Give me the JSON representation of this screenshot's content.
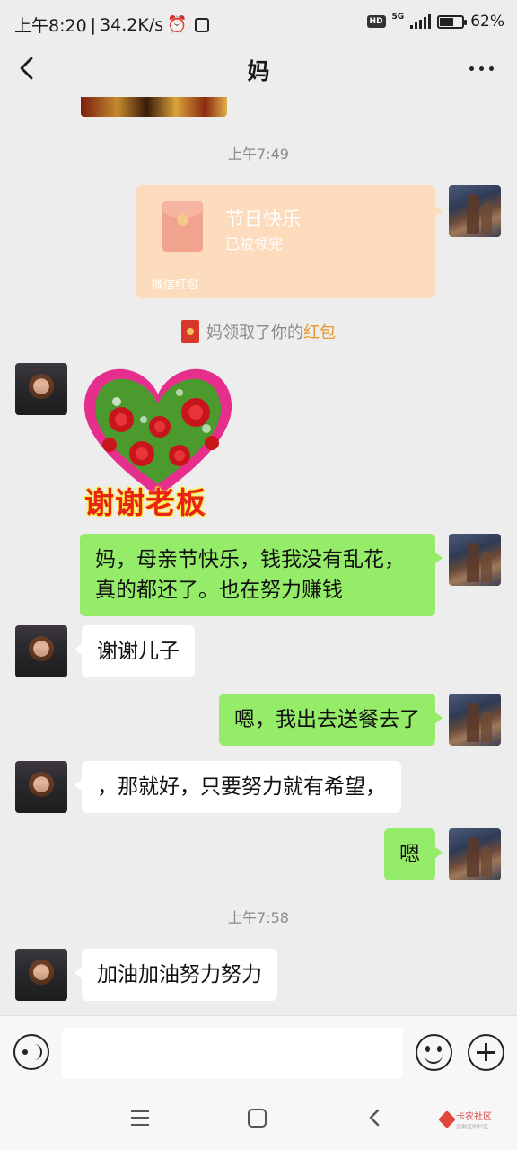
{
  "status_bar": {
    "time": "上午8:20",
    "separator": "|",
    "speed": "34.2K/s",
    "hd_badge": "HD",
    "network": "5G",
    "battery_percent": "62%",
    "battery_level": 0.62
  },
  "header": {
    "title": "妈",
    "back_icon": "chevron-left-icon",
    "more_icon": "more-dots-icon"
  },
  "messages": {
    "time_1": "上午7:49",
    "red_packet": {
      "title": "节日快乐",
      "status": "已被领完",
      "footer": "微信红包"
    },
    "system_note": {
      "prefix": "妈领取了你的",
      "highlight": "红包"
    },
    "sticker_text": "谢谢老板",
    "msg_1": "妈，母亲节快乐，钱我没有乱花，真的都还了。也在努力赚钱",
    "msg_2": "谢谢儿子",
    "msg_3": "嗯，我出去送餐去了",
    "msg_4": "，那就好，只要努力就有希望，",
    "msg_5": "嗯",
    "time_2": "上午7:58",
    "msg_6": "加油加油努力努力"
  },
  "input_bar": {
    "value": "",
    "voice_icon": "voice-icon",
    "emoji_icon": "emoji-icon",
    "plus_icon": "plus-icon"
  },
  "watermark": {
    "name": "卡农社区",
    "sub": "金融互助社区"
  },
  "colors": {
    "background": "#ededed",
    "green_bubble": "#95ec69",
    "red_packet": "#fddbbd",
    "highlight": "#e8992a"
  }
}
